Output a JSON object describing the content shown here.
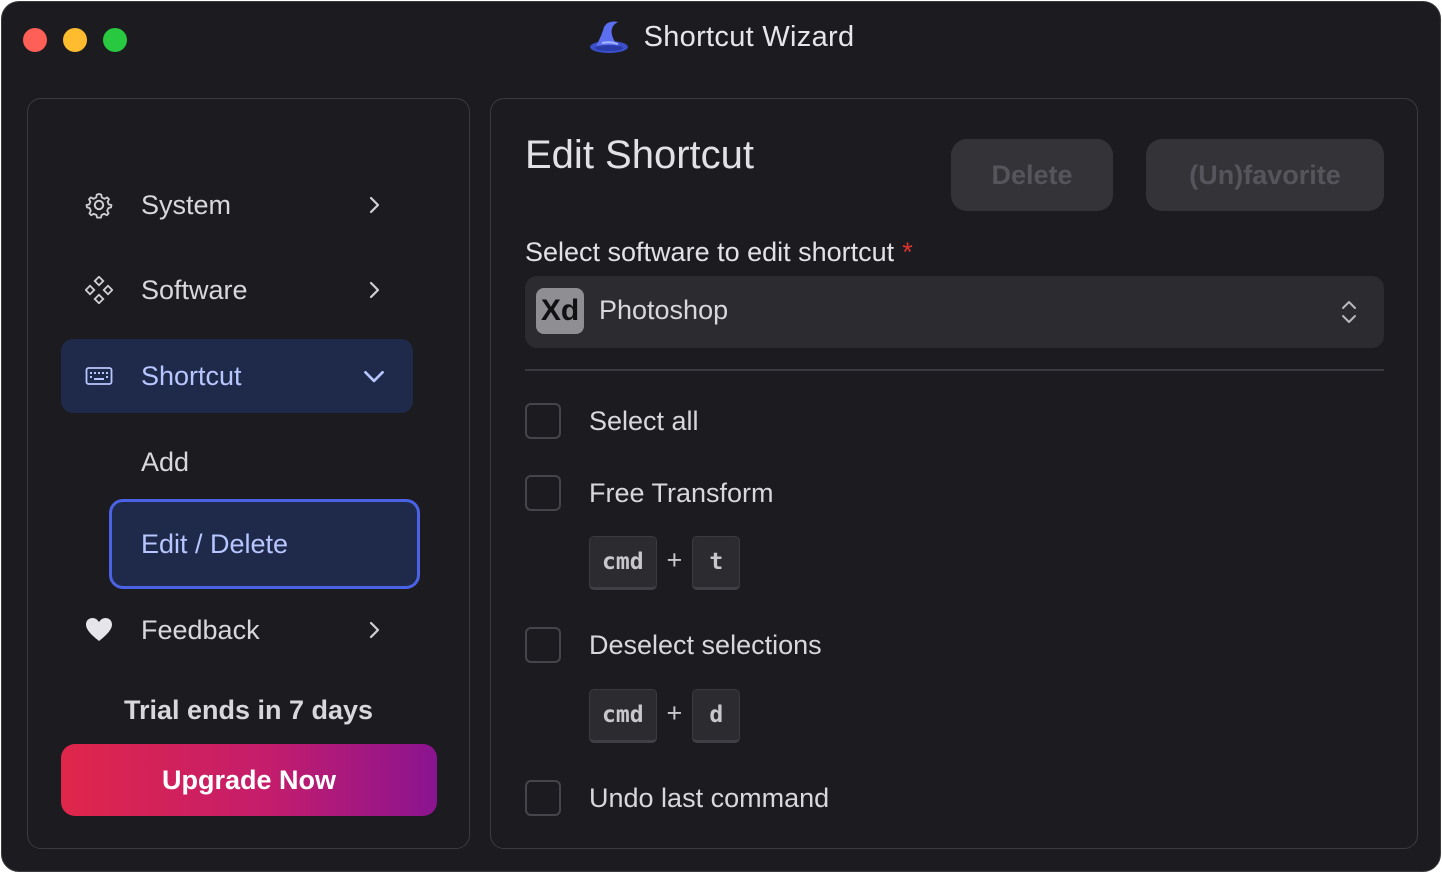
{
  "window": {
    "title": "Shortcut Wizard"
  },
  "sidebar": {
    "items": [
      {
        "label": "System",
        "icon": "gear-icon"
      },
      {
        "label": "Software",
        "icon": "diamond-dots-icon"
      },
      {
        "label": "Shortcut",
        "icon": "keyboard-icon",
        "expanded": true
      },
      {
        "label": "Feedback",
        "icon": "heart-icon"
      }
    ],
    "subitems": [
      {
        "label": "Add"
      },
      {
        "label": "Edit / Delete",
        "selected": true
      }
    ],
    "trial_text": "Trial ends in 7 days",
    "upgrade_label": "Upgrade Now"
  },
  "main": {
    "title": "Edit Shortcut",
    "delete_label": "Delete",
    "favorite_label": "(Un)favorite",
    "field_label": "Select software to edit shortcut",
    "required_mark": "*",
    "software": {
      "badge": "Xd",
      "value": "Photoshop"
    },
    "rows": [
      {
        "label": "Select all"
      },
      {
        "label": "Free Transform",
        "keys": [
          "cmd",
          "t"
        ]
      },
      {
        "label": "Deselect selections",
        "keys": [
          "cmd",
          "d"
        ]
      },
      {
        "label": "Undo last command"
      }
    ],
    "plus": "+"
  },
  "colors": {
    "accent": "#4a62e6",
    "active_bg": "#1f2a4a",
    "upgrade_start": "#e0264a",
    "upgrade_end": "#8a1490",
    "required": "#e0322e"
  }
}
